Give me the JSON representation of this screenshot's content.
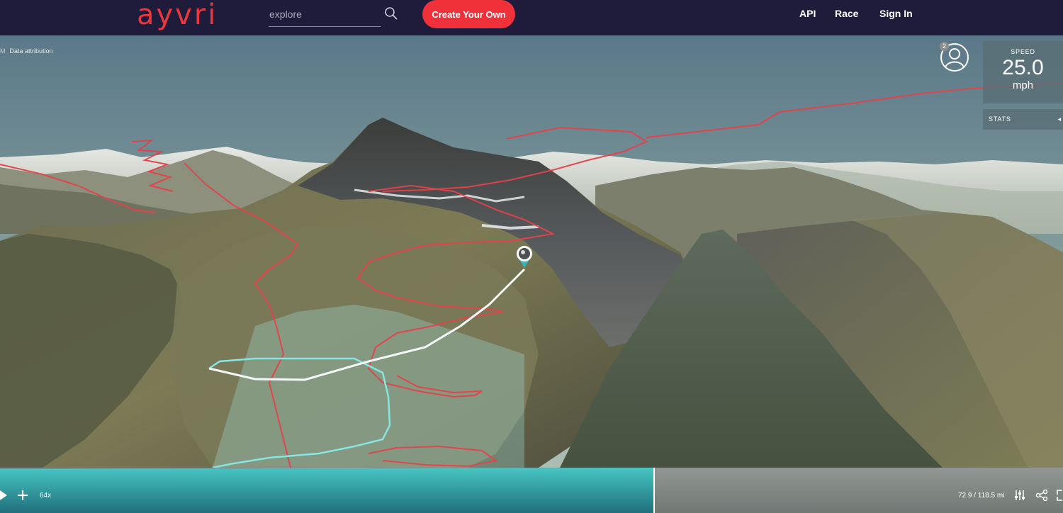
{
  "header": {
    "logo_text": "ayvri",
    "search_placeholder": "explore",
    "create_button": "Create Your Own",
    "nav": [
      "API",
      "Race",
      "Sign In"
    ]
  },
  "map": {
    "attribution_prefix": "M",
    "attribution": "Data attribution"
  },
  "viewer": {
    "badge_count": "2",
    "speed_label": "SPEED",
    "speed_value": "25.0",
    "speed_unit": "mph",
    "stats_label": "STATS"
  },
  "playback": {
    "speed_multiplier": "64x",
    "distance": "72.9 / 118.5 mi",
    "progress_fraction": 0.615
  },
  "colors": {
    "header_bg": "#1f1b3b",
    "brand_red": "#e8383d",
    "button_red": "#f0313a",
    "track_red": "#e5424a",
    "track_cyan": "#7fe3e0",
    "progress_teal": "#3ab7b4"
  },
  "icons": [
    "search-icon",
    "user-icon",
    "play-icon",
    "plus-icon",
    "settings-sliders-icon",
    "share-icon",
    "fullscreen-icon",
    "location-pin-icon"
  ]
}
